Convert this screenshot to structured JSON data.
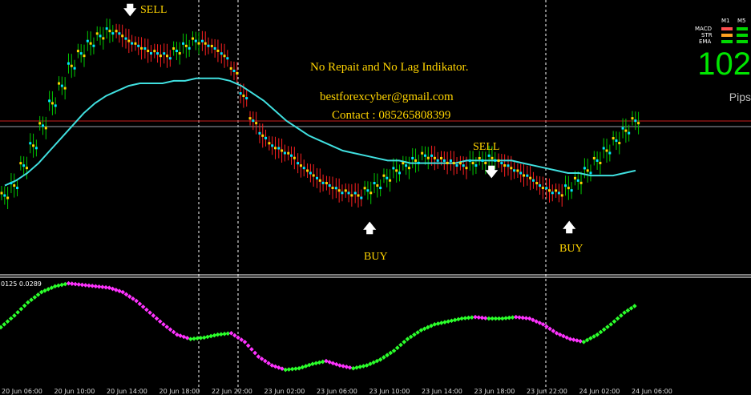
{
  "annotations": {
    "line1": "No Repait and No Lag Indikator.",
    "line2": "bestforexcyber@gmail.com",
    "line3": "Contact : 085265808399"
  },
  "signals": [
    {
      "label": "SELL",
      "arrow": "down"
    },
    {
      "label": "SELL",
      "arrow": "down"
    },
    {
      "label": "BUY",
      "arrow": "up"
    },
    {
      "label": "BUY",
      "arrow": "up"
    }
  ],
  "indicator_panel": {
    "label": "0125 0.0289"
  },
  "info_box": {
    "col_headers": [
      "M1",
      "M5"
    ],
    "rows": [
      "MACD",
      "STR",
      "EMA"
    ],
    "pips_value": "102",
    "pips_label": "Pips"
  },
  "colors": {
    "ma": "#40e0e0",
    "bull_candle": "#00c800",
    "bear_candle": "#ff2020",
    "dot_cyan": "#00e5ff",
    "dot_yellow": "#ffd400",
    "hline_red": "#c81e1e",
    "hline_gray": "#9aa0aa",
    "osc_green": "#2bff2b",
    "osc_magenta": "#ff33ff"
  },
  "chart_data": {
    "type": "line",
    "x_tick_labels": [
      "20 Jun 06:00",
      "20 Jun 10:00",
      "20 Jun 14:00",
      "20 Jun 18:00",
      "22 Jun 22:00",
      "23 Jun 02:00",
      "23 Jun 06:00",
      "23 Jun 10:00",
      "23 Jun 14:00",
      "23 Jun 18:00",
      "23 Jun 22:00",
      "24 Jun 02:00",
      "24 Jun 06:00"
    ],
    "price_series": [
      {
        "name": "",
        "values": [
          18,
          22,
          30,
          38,
          46,
          55,
          62,
          70,
          75,
          79,
          82,
          84,
          83,
          80,
          78,
          76,
          75,
          74,
          76,
          78,
          80,
          79,
          77,
          74,
          68,
          58,
          48,
          42,
          38,
          36,
          34,
          30,
          27,
          24,
          22,
          20,
          19,
          18,
          20,
          22,
          25,
          28,
          30,
          32,
          34,
          33,
          32,
          31,
          30,
          31,
          32,
          33,
          31,
          29,
          27,
          25,
          22,
          20,
          19,
          21,
          24,
          28,
          32,
          36,
          40,
          44,
          48
        ]
      },
      {
        "name": "",
        "values": [
          22,
          24,
          27,
          31,
          36,
          41,
          46,
          51,
          55,
          58,
          60,
          62,
          63,
          63,
          63,
          64,
          64,
          65,
          65,
          65,
          64,
          62,
          59,
          56,
          52,
          48,
          45,
          42,
          40,
          38,
          36,
          35,
          34,
          33,
          32,
          32,
          31,
          31,
          31,
          31,
          31,
          32,
          32,
          32,
          32,
          32,
          31,
          30,
          29,
          28,
          27,
          27,
          26,
          26,
          26,
          27,
          28
        ]
      }
    ],
    "oscillator": {
      "values": [
        38,
        46,
        55,
        62,
        66,
        68,
        67,
        66,
        65,
        62,
        56,
        48,
        40,
        33,
        30,
        31,
        33,
        34,
        28,
        18,
        12,
        9,
        10,
        13,
        15,
        12,
        10,
        12,
        16,
        22,
        30,
        36,
        40,
        42,
        44,
        45,
        44,
        44,
        45,
        44,
        40,
        34,
        30,
        28,
        33,
        40,
        48,
        54
      ]
    },
    "horizontal_lines": [
      {
        "color": "red"
      },
      {
        "color": "gray"
      }
    ],
    "vertical_lines": 3,
    "grid": false
  }
}
